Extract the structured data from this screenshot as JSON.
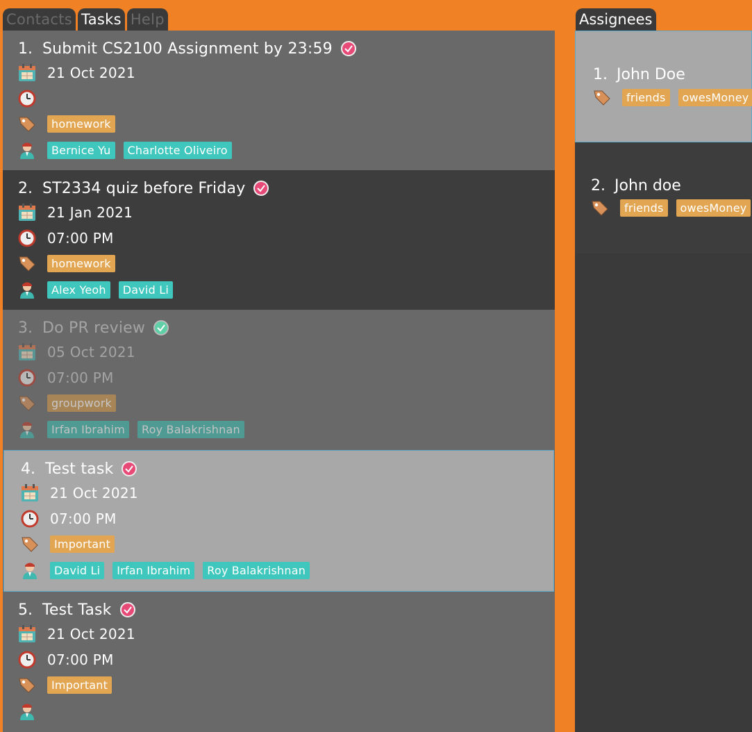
{
  "tabs": {
    "contacts": "Contacts",
    "tasks": "Tasks",
    "help": "Help"
  },
  "right_panel": {
    "title": "Assignees"
  },
  "colors": {
    "window_bg": "#f08125",
    "tag_chip": "#e2a552",
    "person_chip": "#3fc7bd",
    "check_pink": "#e84a78",
    "check_green": "#5fcfa5"
  },
  "tasks": [
    {
      "num": "1.",
      "title": "Submit CS2100 Assignment by 23:59",
      "status": "check-pink-icon",
      "date": "21 Oct 2021",
      "time": "",
      "tags": [
        "homework"
      ],
      "assignees": [
        "Bernice Yu",
        "Charlotte Oliveiro"
      ]
    },
    {
      "num": "2.",
      "title": "ST2334 quiz before Friday",
      "status": "check-pink-icon",
      "date": "21 Jan 2021",
      "time": "07:00 PM",
      "tags": [
        "homework"
      ],
      "assignees": [
        "Alex Yeoh",
        "David Li"
      ]
    },
    {
      "num": "3.",
      "title": "Do PR review",
      "status": "check-green-icon",
      "date": "05 Oct 2021",
      "time": "07:00 PM",
      "tags": [
        "groupwork"
      ],
      "assignees": [
        "Irfan Ibrahim",
        "Roy Balakrishnan"
      ]
    },
    {
      "num": "4.",
      "title": "Test task",
      "status": "check-pink-icon",
      "date": "21 Oct 2021",
      "time": "07:00 PM",
      "tags": [
        "Important"
      ],
      "assignees": [
        "David Li",
        "Irfan Ibrahim",
        "Roy Balakrishnan"
      ]
    },
    {
      "num": "5.",
      "title": "Test Task",
      "status": "check-pink-icon",
      "date": "21 Oct 2021",
      "time": "07:00 PM",
      "tags": [
        "Important"
      ],
      "assignees": []
    }
  ],
  "assignees": [
    {
      "num": "1.",
      "name": "John Doe",
      "tags": [
        "friends",
        "owesMoney"
      ]
    },
    {
      "num": "2.",
      "name": "John doe",
      "tags": [
        "friends",
        "owesMoney"
      ]
    }
  ]
}
